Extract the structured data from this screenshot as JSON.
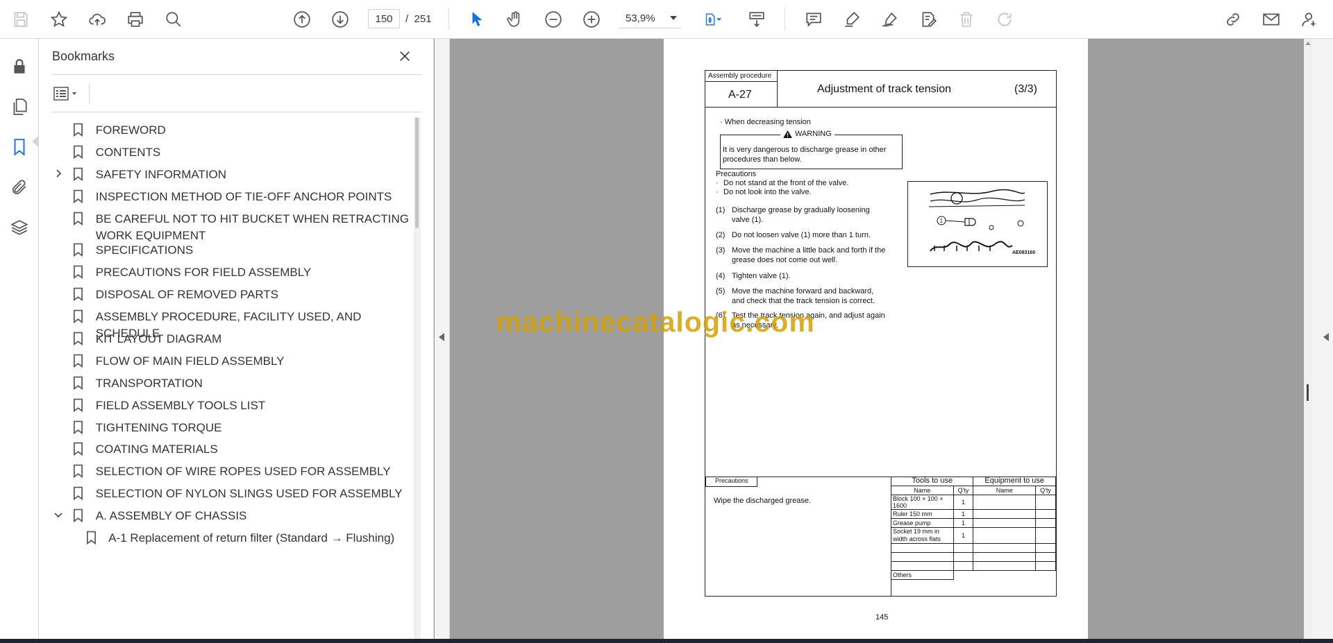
{
  "toolbar": {
    "current_page": "150",
    "page_separator": "/",
    "total_pages": "251",
    "zoom": "53,9%"
  },
  "bookmarks_panel": {
    "title": "Bookmarks",
    "items": [
      {
        "label": "FOREWORD",
        "expander": "none"
      },
      {
        "label": "CONTENTS",
        "expander": "none"
      },
      {
        "label": "SAFETY INFORMATION",
        "expander": "collapsed"
      },
      {
        "label": "INSPECTION METHOD OF TIE-OFF ANCHOR POINTS",
        "expander": "none"
      },
      {
        "label": "BE CAREFUL NOT TO HIT BUCKET WHEN RETRACTING WORK EQUIPMENT",
        "expander": "none"
      },
      {
        "label": "SPECIFICATIONS",
        "expander": "none"
      },
      {
        "label": "PRECAUTIONS FOR FIELD ASSEMBLY",
        "expander": "none"
      },
      {
        "label": "DISPOSAL OF REMOVED PARTS",
        "expander": "none"
      },
      {
        "label": "ASSEMBLY PROCEDURE, FACILITY USED, AND SCHEDULE",
        "expander": "none"
      },
      {
        "label": "KIT LAYOUT DIAGRAM",
        "expander": "none"
      },
      {
        "label": "FLOW OF MAIN FIELD ASSEMBLY",
        "expander": "none"
      },
      {
        "label": "TRANSPORTATION",
        "expander": "none"
      },
      {
        "label": "FIELD ASSEMBLY TOOLS LIST",
        "expander": "none"
      },
      {
        "label": "TIGHTENING TORQUE",
        "expander": "none"
      },
      {
        "label": "COATING MATERIALS",
        "expander": "none"
      },
      {
        "label": "SELECTION OF WIRE ROPES USED FOR ASSEMBLY",
        "expander": "none"
      },
      {
        "label": "SELECTION OF NYLON SLINGS USED FOR ASSEMBLY",
        "expander": "none"
      },
      {
        "label": "A. ASSEMBLY OF CHASSIS",
        "expander": "expanded"
      },
      {
        "label": "A-1 Replacement of return filter (Standard → Flushing)",
        "expander": "none",
        "child": true
      }
    ]
  },
  "document": {
    "header": {
      "label": "Assembly procedure",
      "code": "A-27",
      "title": "Adjustment of track tension",
      "part": "(3/3)"
    },
    "case": "· When decreasing tension",
    "warning_title": "WARNING",
    "warning_text": "It is very dangerous to discharge grease in other procedures than below.",
    "precautions_heading": "Precautions",
    "precautions": [
      {
        "bullet": "·",
        "text": "Do not stand at the front of the valve."
      },
      {
        "bullet": "·",
        "text": "Do not look into the valve."
      }
    ],
    "steps": [
      {
        "num": "(1)",
        "text": "Discharge grease by gradually loosening valve (1)."
      },
      {
        "num": "(2)",
        "text": "Do not loosen valve (1) more than 1 turn."
      },
      {
        "num": "(3)",
        "text": "Move the machine a little back and forth if the grease does not come out well."
      },
      {
        "num": "(4)",
        "text": "Tighten valve (1)."
      },
      {
        "num": "(5)",
        "text": "Move the machine forward and backward, and check that the track tension is correct."
      },
      {
        "num": "(6)",
        "text": "Test the track tension again, and adjust again as necessary."
      }
    ],
    "figure_code": "AE083160",
    "figure_callout": "1",
    "bottom_precautions_label": "Precautions",
    "bottom_precautions_text": "Wipe the discharged grease.",
    "tools_header": "Tools to use",
    "equipment_header": "Equipment  to use",
    "col_name": "Name",
    "col_qty": "Q'ty",
    "tools": [
      {
        "name": "Block 100 × 100 × 1600",
        "qty": "1"
      },
      {
        "name": "Ruler 150 mm",
        "qty": "1"
      },
      {
        "name": "Grease pump",
        "qty": "1"
      },
      {
        "name": "Socket 19 mm in width across flats",
        "qty": "1"
      }
    ],
    "others_label": "Others",
    "page_number": "145"
  },
  "watermark": "machinecatalogic.com"
}
